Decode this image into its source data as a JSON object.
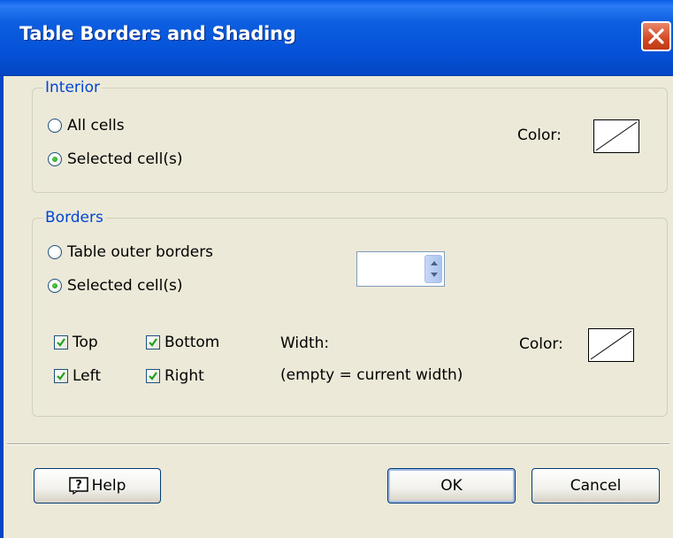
{
  "window": {
    "title": "Table Borders and Shading"
  },
  "interior": {
    "legend": "Interior",
    "all_cells_label": "All cells",
    "selected_cells_label": "Selected cell(s)",
    "selected": "selected_cells",
    "color_label": "Color:"
  },
  "borders": {
    "legend": "Borders",
    "outer_label": "Table outer borders",
    "selected_cells_label": "Selected cell(s)",
    "selected": "selected_cells",
    "top_label": "Top",
    "top_checked": true,
    "bottom_label": "Bottom",
    "bottom_checked": true,
    "left_label": "Left",
    "left_checked": true,
    "right_label": "Right",
    "right_checked": true,
    "width_label": "Width:",
    "width_value": "",
    "width_hint": "(empty = current width)",
    "color_label": "Color:"
  },
  "buttons": {
    "help_label": "Help",
    "ok_label": "OK",
    "cancel_label": "Cancel"
  },
  "colors": {
    "titlebar": "#0552d8",
    "legend_text": "#0046d5",
    "dialog_bg": "#ece9d8",
    "close_button": "#d24a24"
  },
  "icons": {
    "close": "close-icon",
    "help": "help-icon",
    "spinner": "spinner-arrows-icon"
  }
}
